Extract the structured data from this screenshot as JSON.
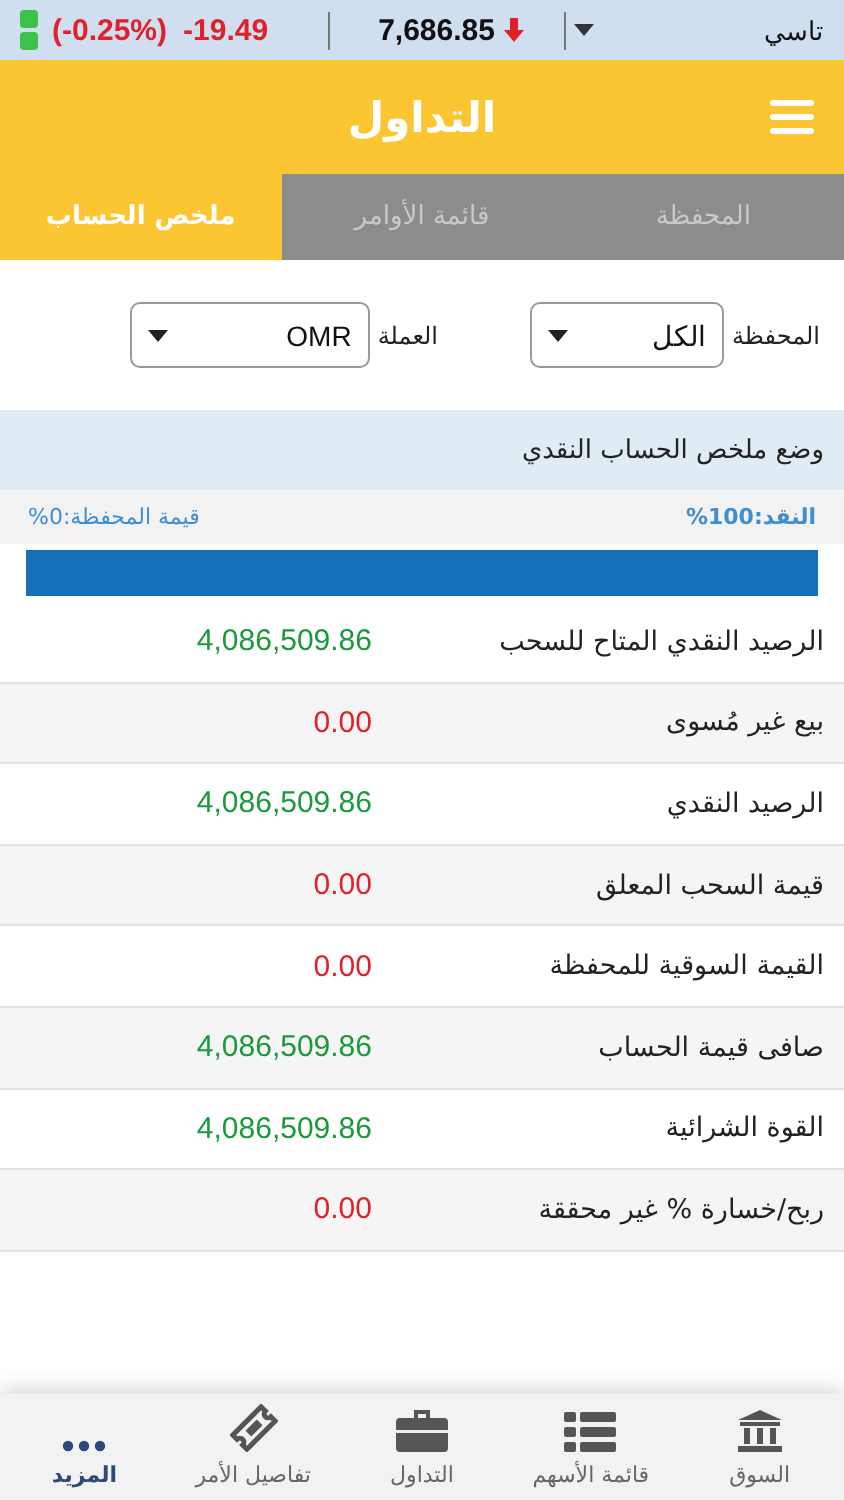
{
  "ticker": {
    "name": "تاسي",
    "value": "7,686.85",
    "change": "-19.49",
    "change_percent": "(-0.25%)"
  },
  "header": {
    "title": "التداول"
  },
  "tabs": [
    {
      "label": "المحفظة",
      "selected": false
    },
    {
      "label": "قائمة الأوامر",
      "selected": false
    },
    {
      "label": "ملخص الحساب",
      "selected": true
    }
  ],
  "filters": [
    {
      "label": "المحفظة",
      "value": "الكل"
    },
    {
      "label": "العملة",
      "value": "OMR"
    }
  ],
  "summary": {
    "title": "وضع ملخص الحساب النقدي",
    "cash_label": "النقد:100%",
    "portfolio_label": "قيمة المحفظة:0%",
    "cash_share": {
      "level": 1
    }
  },
  "rows": [
    {
      "label": "الرصيد النقدي المتاح للسحب",
      "value": "4,086,509.86",
      "color": "#1a9a3a"
    },
    {
      "label": "بيع غير مُسوى",
      "value": "0.00",
      "color": "#e0202a"
    },
    {
      "label": "الرصيد النقدي",
      "value": "4,086,509.86",
      "color": "#1a9a3a"
    },
    {
      "label": "قيمة السحب المعلق",
      "value": "0.00",
      "color": "#e0202a"
    },
    {
      "label": "القيمة السوقية للمحفظة",
      "value": "0.00",
      "color": "#e0202a"
    },
    {
      "label": "صافى قيمة الحساب",
      "value": "4,086,509.86",
      "color": "#1a9a3a"
    },
    {
      "label": "القوة الشرائية",
      "value": "4,086,509.86",
      "color": "#1a9a3a"
    },
    {
      "label": "ربح/خسارة % غير محققة",
      "value": "0.00",
      "color": "#e0202a"
    }
  ],
  "nav": [
    {
      "label": "السوق",
      "kind": "bank",
      "selected": false
    },
    {
      "label": "قائمة الأسهم",
      "kind": "list",
      "selected": false
    },
    {
      "label": "التداول",
      "kind": "briefcase",
      "selected": false
    },
    {
      "label": "تفاصيل الأمر",
      "kind": "ticket",
      "selected": false
    },
    {
      "label": "المزيد",
      "kind": "more",
      "selected": true
    }
  ]
}
